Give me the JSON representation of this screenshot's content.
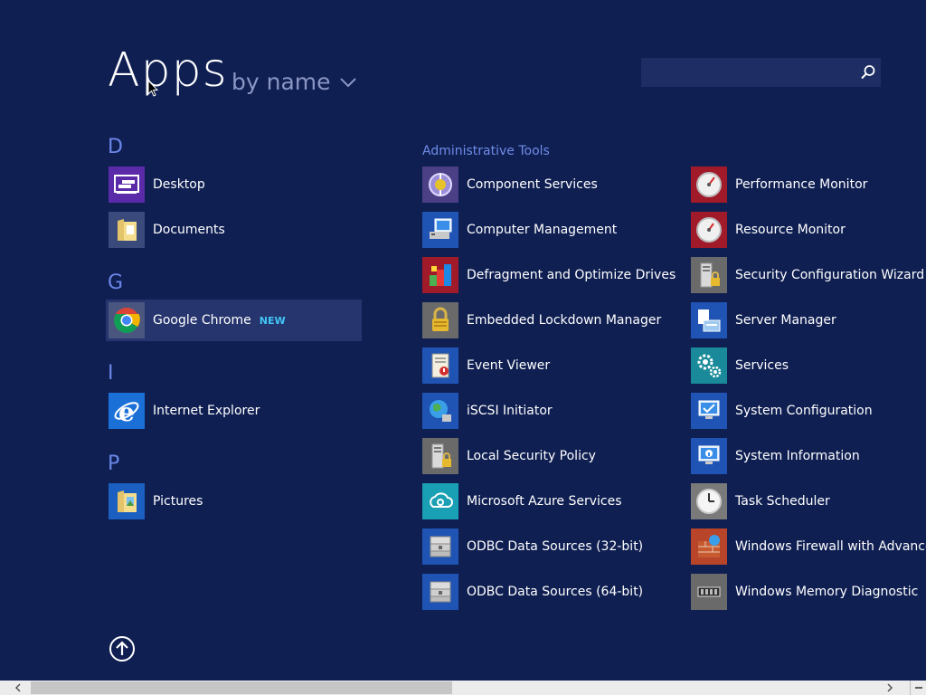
{
  "header": {
    "title": "Apps",
    "sort_label": "by name"
  },
  "search": {
    "value": "",
    "placeholder": ""
  },
  "letters": {
    "d": "D",
    "g": "G",
    "i": "I",
    "p": "P"
  },
  "groups": {
    "admin_tools": "Administrative Tools"
  },
  "apps": {
    "desktop": "Desktop",
    "documents": "Documents",
    "chrome": "Google Chrome",
    "chrome_badge": "NEW",
    "ie": "Internet Explorer",
    "pictures": "Pictures"
  },
  "admin_col1": [
    "Component Services",
    "Computer Management",
    "Defragment and Optimize Drives",
    "Embedded Lockdown Manager",
    "Event Viewer",
    "iSCSI Initiator",
    "Local Security Policy",
    "Microsoft Azure Services",
    "ODBC Data Sources (32-bit)",
    "ODBC Data Sources (64-bit)"
  ],
  "admin_col2": [
    "Performance Monitor",
    "Resource Monitor",
    "Security Configuration Wizard",
    "Server Manager",
    "Services",
    "System Configuration",
    "System Information",
    "Task Scheduler",
    "Windows Firewall with Advanced",
    "Windows Memory Diagnostic"
  ],
  "colors": {
    "background": "#0f1f52",
    "letter": "#6b86e8",
    "badge": "#41c6f5",
    "selection": "#26356e"
  },
  "scrollbar": {
    "position_fraction": 0.03,
    "visible_fraction": 0.46
  }
}
